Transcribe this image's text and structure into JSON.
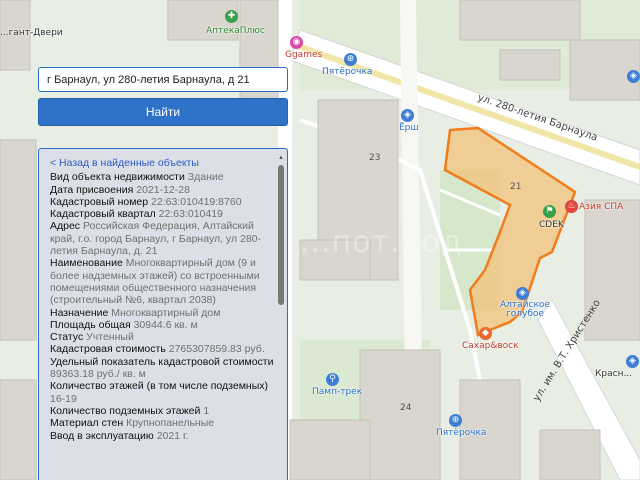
{
  "search": {
    "value": "г Барнаул, ул 280-летия Барнаула, д 21",
    "button_label": "Найти"
  },
  "panel": {
    "back_link": "< Назад в найденные объекты",
    "rows": [
      {
        "label": "Вид объекта недвижимости",
        "value": "Здание"
      },
      {
        "label": "Дата присвоения",
        "value": "2021-12-28"
      },
      {
        "label": "Кадастровый номер",
        "value": "22:63:010419:8760"
      },
      {
        "label": "Кадастровый квартал",
        "value": "22:63:010419"
      },
      {
        "label": "Адрес",
        "value": "Российская Федерация, Алтайский край, г.о. город Барнаул, г Барнаул, ул 280-летия Барнаула, д. 21"
      },
      {
        "label": "Наименование",
        "value": "Многоквартирный дом (9 и более надземных этажей) со встроенными помещениями общественного назначения (строительный №6, квартал 2038)"
      },
      {
        "label": "Назначение",
        "value": "Многоквартирный дом"
      },
      {
        "label": "Площадь общая",
        "value": "30944.6 кв. м"
      },
      {
        "label": "Статус",
        "value": "Учтенный"
      },
      {
        "label": "Кадастровая стоимость",
        "value": "2765307859.83 руб."
      },
      {
        "label": "Удельный показатель кадастровой стоимости",
        "value": "89363.18 руб./ кв. м"
      },
      {
        "label": "Количество этажей (в том числе подземных)",
        "value": "16-19"
      },
      {
        "label": "Количество подземных этажей",
        "value": "1"
      },
      {
        "label": "Материал стен",
        "value": "Крупнопанельные"
      },
      {
        "label": "Ввод в эксплуатацию",
        "value": "2021 г."
      }
    ]
  },
  "map": {
    "pois": {
      "apteka": "АптекаПлюс",
      "ggames": "Ggames",
      "pyaterochka_top": "Пятёрочка",
      "ersh": "Ёрш",
      "cdek": "CDEK",
      "azia_spa": "Азия СПА",
      "altai_blue": "Алтайское голубое",
      "sakharok": "Сахар&воск",
      "pamp_trek": "Памп-трек",
      "pyaterochka_bottom": "Пятёрочка",
      "dveri": "...гант-Двери",
      "krasnoe": "Красн..."
    },
    "building_numbers": {
      "b23": "23",
      "b21": "21",
      "b24": "24"
    },
    "streets": {
      "street_280": "ул. 280-летия Барнаула",
      "street_khristenko": "ул. им. В.Т. Христенко"
    },
    "colors": {
      "parcel_outline": "#f07c1a",
      "parcel_fill": "#f2c27a",
      "accent": "#2f73c9"
    }
  }
}
